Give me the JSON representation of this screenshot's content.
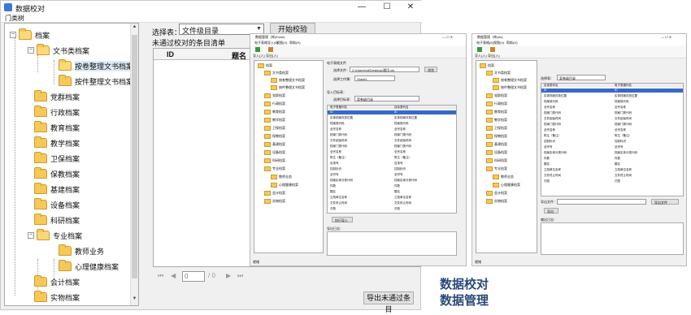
{
  "main_window": {
    "title": "数据校对",
    "minimize": "—",
    "maximize": "☐",
    "close": "✕",
    "menu": "门类树"
  },
  "tree": {
    "root": "档案",
    "items": [
      {
        "label": "文书类档案",
        "level": 1
      },
      {
        "label": "按卷整理文书档案",
        "level": 2
      },
      {
        "label": "按件整理文书档案",
        "level": 2
      },
      {
        "label": "党群档案",
        "level": 1
      },
      {
        "label": "行政档案",
        "level": 1
      },
      {
        "label": "教育档案",
        "level": 1
      },
      {
        "label": "教学档案",
        "level": 1
      },
      {
        "label": "卫保档案",
        "level": 1
      },
      {
        "label": "保教档案",
        "level": 1
      },
      {
        "label": "基建档案",
        "level": 1
      },
      {
        "label": "设备档案",
        "level": 1
      },
      {
        "label": "科研档案",
        "level": 1
      },
      {
        "label": "专业档案",
        "level": 1
      },
      {
        "label": "教师业务",
        "level": 2
      },
      {
        "label": "心理健康档案",
        "level": 2
      },
      {
        "label": "会计档案",
        "level": 1
      },
      {
        "label": "实物档案",
        "level": 1
      }
    ]
  },
  "toolbar": {
    "select_label": "选择表：",
    "select_value": "文件级目录",
    "check_button": "开始校验"
  },
  "grid": {
    "title": "未通过校对的条目清单",
    "columns": [
      "ID",
      "题名"
    ]
  },
  "pager": {
    "first": "⏮",
    "prev": "◀",
    "page_value": "0",
    "page_total": "/ 0",
    "next": "▶",
    "last": "⏭"
  },
  "export_button": "导出未通过条目",
  "thumb1": {
    "title": "数据管理（库(Excel)",
    "menus": [
      "电子表格导入(E)",
      "视图(V)",
      "帮助(H)"
    ],
    "tools": [
      "导入(入)",
      "导出(入)"
    ],
    "file_label": "电子表格文件",
    "select_file": "选择文件：",
    "file_path": "C:\\Users\\hd\\Desktop\\通讯.xls",
    "browse": "浏览",
    "sheet_label": "选择工作簿：",
    "sheet_value": "Sheet1",
    "import_label": "导入目标表：",
    "target_label": "选择目标表：",
    "target_value": "案卷级目录",
    "col_a": "电子表格列名",
    "col_b": "目标表列名",
    "rows": [
      [
        "ID",
        "ID"
      ],
      [
        "实体档案存放位置",
        "实体档案存放位置"
      ],
      [
        "档案馆代码",
        "档案馆代码"
      ],
      [
        "全宗名称",
        "全宗名称"
      ],
      [
        "档案门类代码",
        "档案门类代码"
      ],
      [
        "文件起始时间",
        "文件起始时间"
      ],
      [
        "档案门类代码",
        "档案门类代码"
      ],
      [
        "全宗名称",
        "全宗名称"
      ],
      [
        "附注（备注）",
        "附注（备注）"
      ],
      [
        "目录号",
        "目录号"
      ],
      [
        "控制标识",
        "控制标识"
      ],
      [
        "全宗号",
        "全宗号"
      ],
      [
        "档案实体分类代码",
        "档案实体分类代码"
      ],
      [
        "件数",
        "件数"
      ],
      [
        "题名",
        "题名"
      ],
      [
        "立档单位名称",
        "立档单位名称"
      ],
      [
        "文件终止时间",
        "文件终止时间"
      ],
      [
        "归档",
        "归档"
      ]
    ],
    "run_button": "执行导入",
    "log_label": "导出日志：",
    "status": "就绪"
  },
  "thumb2": {
    "title": "数据管理（库(xls)",
    "menus": [
      "电子表格(E)",
      "视图(V)",
      "帮助(H)"
    ],
    "tools": [
      "导入(入)",
      "导出(入)"
    ],
    "select_label": "选择表：",
    "select_value": "案卷级目录",
    "col_a": "目录表列名",
    "col_b": "电子表格列名",
    "rows": [
      [
        "ID",
        "ID"
      ],
      [
        "实体档案存放位置",
        "实体档案存放位置"
      ],
      [
        "档案馆代码",
        "档案馆代码"
      ],
      [
        "全宗名称",
        "全宗名称"
      ],
      [
        "档案门类代码",
        "档案门类代码"
      ],
      [
        "文件起始时间",
        "文件起始时间"
      ],
      [
        "档案门类代码",
        "档案门类代码"
      ],
      [
        "全宗名称",
        "全宗名称"
      ],
      [
        "附注（备注）",
        "附注（备注）"
      ],
      [
        "控制标识",
        "控制标识"
      ],
      [
        "全宗号",
        "全宗号"
      ],
      [
        "档案实体分类代码",
        "档案实体分类代码"
      ],
      [
        "件数",
        "件数"
      ],
      [
        "题名",
        "题名"
      ],
      [
        "立档单位名称",
        "立档单位名称"
      ],
      [
        "文件终止时间",
        "文件终止时间"
      ],
      [
        "归档",
        "归档"
      ]
    ],
    "export_file_label": "导出文件：",
    "export_file_button": "导出文件",
    "run_button": "导出",
    "log_label": "输出日志：",
    "status": "就绪"
  },
  "captions": [
    "数据校对",
    "数据管理"
  ]
}
